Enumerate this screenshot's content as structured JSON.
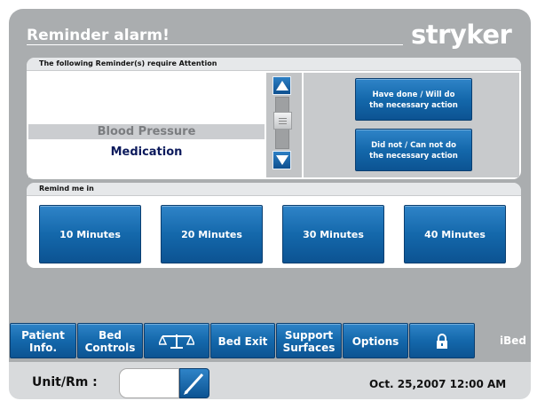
{
  "header": {
    "title": "Reminder alarm!",
    "logo": "stryker"
  },
  "reminders": {
    "heading": "The following Reminder(s) require Attention",
    "items": [
      "Blood Pressure",
      "Medication"
    ],
    "selected_index": 0,
    "scroll_up_icon": "arrow-up-icon",
    "scroll_down_icon": "arrow-down-icon"
  },
  "actions": {
    "done_line1": "Have done / Will do",
    "done_line2": "the necessary action",
    "notdone_line1": "Did not / Can not do",
    "notdone_line2": "the necessary action"
  },
  "remind": {
    "heading": "Remind me in",
    "options": [
      "10 Minutes",
      "20 Minutes",
      "30 Minutes",
      "40 Minutes"
    ]
  },
  "nav": {
    "patient_line1": "Patient",
    "patient_line2": "Info.",
    "bed_line1": "Bed",
    "bed_line2": "Controls",
    "scale_icon": "scale-icon",
    "bed_exit": "Bed Exit",
    "support_line1": "Support",
    "support_line2": "Surfaces",
    "options": "Options",
    "lock_icon": "lock-icon",
    "ibed": "iBed"
  },
  "footer": {
    "unit_label": "Unit/Rm :",
    "unit_value": "",
    "edit_icon": "pencil-icon",
    "datetime": "Oct. 25,2007  12:00 AM"
  },
  "colors": {
    "accent_blue": "#1468ab",
    "panel_grey": "#aaadaf",
    "text_navy": "#0c1a5c"
  }
}
